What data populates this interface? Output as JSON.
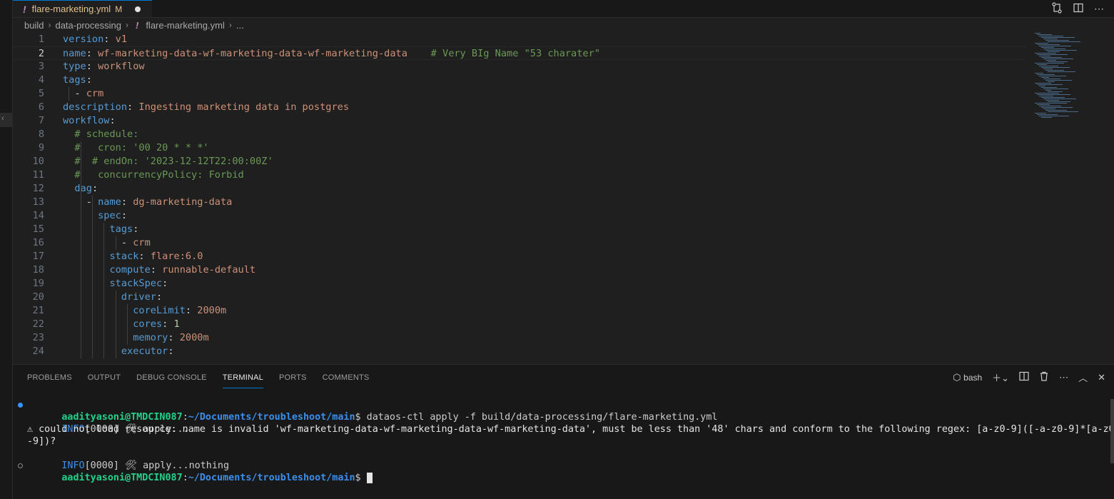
{
  "tab": {
    "filename": "flare-marketing.yml",
    "modified": "M",
    "icon": "!"
  },
  "tab_actions": [
    "git-compare-icon",
    "split-editor-icon",
    "more-icon"
  ],
  "breadcrumb": {
    "items": [
      "build",
      "data-processing"
    ],
    "file": "flare-marketing.yml",
    "more": "..."
  },
  "editor": {
    "current_line": 2,
    "lines": [
      {
        "n": "1",
        "segs": [
          [
            "k",
            "version"
          ],
          [
            "p",
            ": "
          ],
          [
            "v",
            "v1"
          ]
        ]
      },
      {
        "n": "2",
        "segs": [
          [
            "k",
            "name"
          ],
          [
            "p",
            ": "
          ],
          [
            "v",
            "wf-marketing-data-wf-marketing-data-wf-marketing-data"
          ],
          [
            "p",
            "    "
          ],
          [
            "c",
            "# Very BIg Name \"53 charater\""
          ]
        ]
      },
      {
        "n": "3",
        "segs": [
          [
            "k",
            "type"
          ],
          [
            "p",
            ": "
          ],
          [
            "v",
            "workflow"
          ]
        ]
      },
      {
        "n": "4",
        "segs": [
          [
            "k",
            "tags"
          ],
          [
            "p",
            ":"
          ]
        ]
      },
      {
        "n": "5",
        "segs": [
          [
            "p",
            "  - "
          ],
          [
            "v",
            "crm"
          ]
        ]
      },
      {
        "n": "6",
        "segs": [
          [
            "k",
            "description"
          ],
          [
            "p",
            ": "
          ],
          [
            "v",
            "Ingesting marketing data in postgres"
          ]
        ]
      },
      {
        "n": "7",
        "segs": [
          [
            "k",
            "workflow"
          ],
          [
            "p",
            ":"
          ]
        ]
      },
      {
        "n": "8",
        "segs": [
          [
            "p",
            "  "
          ],
          [
            "c",
            "# schedule:"
          ]
        ]
      },
      {
        "n": "9",
        "segs": [
          [
            "p",
            "  "
          ],
          [
            "c",
            "#   cron: '00 20 * * *'"
          ]
        ]
      },
      {
        "n": "10",
        "segs": [
          [
            "p",
            "  "
          ],
          [
            "c",
            "#  # endOn: '2023-12-12T22:00:00Z'"
          ]
        ]
      },
      {
        "n": "11",
        "segs": [
          [
            "p",
            "  "
          ],
          [
            "c",
            "#   concurrencyPolicy: Forbid"
          ]
        ]
      },
      {
        "n": "12",
        "segs": [
          [
            "p",
            "  "
          ],
          [
            "k",
            "dag"
          ],
          [
            "p",
            ":"
          ]
        ]
      },
      {
        "n": "13",
        "segs": [
          [
            "p",
            "    - "
          ],
          [
            "k",
            "name"
          ],
          [
            "p",
            ": "
          ],
          [
            "v",
            "dg-marketing-data"
          ]
        ]
      },
      {
        "n": "14",
        "segs": [
          [
            "p",
            "      "
          ],
          [
            "k",
            "spec"
          ],
          [
            "p",
            ":"
          ]
        ]
      },
      {
        "n": "15",
        "segs": [
          [
            "p",
            "        "
          ],
          [
            "k",
            "tags"
          ],
          [
            "p",
            ":"
          ]
        ]
      },
      {
        "n": "16",
        "segs": [
          [
            "p",
            "          - "
          ],
          [
            "v",
            "crm"
          ]
        ]
      },
      {
        "n": "17",
        "segs": [
          [
            "p",
            "        "
          ],
          [
            "k",
            "stack"
          ],
          [
            "p",
            ": "
          ],
          [
            "v",
            "flare:6.0"
          ]
        ]
      },
      {
        "n": "18",
        "segs": [
          [
            "p",
            "        "
          ],
          [
            "k",
            "compute"
          ],
          [
            "p",
            ": "
          ],
          [
            "v",
            "runnable-default"
          ]
        ]
      },
      {
        "n": "19",
        "segs": [
          [
            "p",
            "        "
          ],
          [
            "k",
            "stackSpec"
          ],
          [
            "p",
            ":"
          ]
        ]
      },
      {
        "n": "20",
        "segs": [
          [
            "p",
            "          "
          ],
          [
            "k",
            "driver"
          ],
          [
            "p",
            ":"
          ]
        ]
      },
      {
        "n": "21",
        "segs": [
          [
            "p",
            "            "
          ],
          [
            "k",
            "coreLimit"
          ],
          [
            "p",
            ": "
          ],
          [
            "v",
            "2000m"
          ]
        ]
      },
      {
        "n": "22",
        "segs": [
          [
            "p",
            "            "
          ],
          [
            "k",
            "cores"
          ],
          [
            "p",
            ": "
          ],
          [
            "n",
            "1"
          ]
        ]
      },
      {
        "n": "23",
        "segs": [
          [
            "p",
            "            "
          ],
          [
            "k",
            "memory"
          ],
          [
            "p",
            ": "
          ],
          [
            "v",
            "2000m"
          ]
        ]
      },
      {
        "n": "24",
        "segs": [
          [
            "p",
            "          "
          ],
          [
            "k",
            "executor"
          ],
          [
            "p",
            ":"
          ]
        ]
      }
    ]
  },
  "panel": {
    "tabs": [
      "PROBLEMS",
      "OUTPUT",
      "DEBUG CONSOLE",
      "TERMINAL",
      "PORTS",
      "COMMENTS"
    ],
    "active_tab": "TERMINAL",
    "shell": "bash"
  },
  "terminal": {
    "prompt_user": "aadityasoni@TMDCIN087",
    "prompt_path": "~/Documents/troubleshoot/main",
    "command": "dataos-ctl apply -f build/data-processing/flare-marketing.yml",
    "lines": [
      {
        "tag": "INFO",
        "rest": "[0000] 🛠 apply..."
      },
      {
        "warn": "⚠ could not load resource: name is invalid 'wf-marketing-data-wf-marketing-data-wf-marketing-data', must be less than '48' chars and conform to the following regex: [a-z0-9]([-a-z0-9]*[a-z0"
      },
      {
        "warn": "-9])?"
      },
      {
        "tag": "INFO",
        "rest": "[0000] 🛠 apply...nothing"
      }
    ]
  }
}
